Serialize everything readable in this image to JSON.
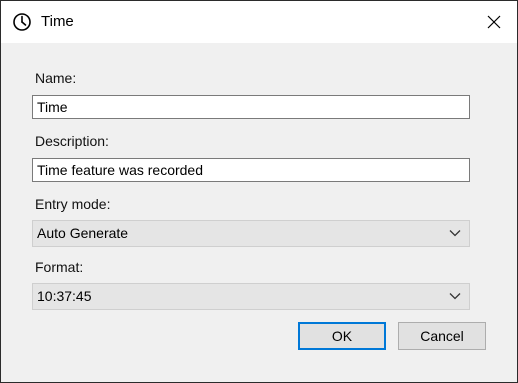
{
  "window": {
    "title": "Time",
    "title_icon": "clock-icon",
    "close_icon": "close-icon"
  },
  "form": {
    "name_label": "Name:",
    "name_value": "Time",
    "description_label": "Description:",
    "description_value": "Time feature was recorded",
    "entry_mode_label": "Entry mode:",
    "entry_mode_value": "Auto Generate",
    "format_label": "Format:",
    "format_value": "10:37:45"
  },
  "buttons": {
    "ok_label": "OK",
    "cancel_label": "Cancel"
  },
  "colors": {
    "accent": "#0078d7",
    "dialog_background": "#f0f0f0",
    "titlebar_background": "#ffffff",
    "dropdown_background": "#e5e5e5"
  }
}
